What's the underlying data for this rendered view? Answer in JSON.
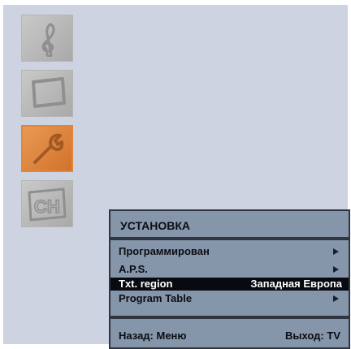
{
  "side_menu": {
    "items": [
      {
        "icon": "sound-clef-icon",
        "active": false
      },
      {
        "icon": "picture-screen-icon",
        "active": false
      },
      {
        "icon": "wrench-icon",
        "active": true
      },
      {
        "icon": "channel-ch-icon",
        "active": false
      }
    ]
  },
  "icon_text": {
    "channel": "CH"
  },
  "setup_menu": {
    "title": "УСТАНОВКА",
    "rows": [
      {
        "label": "Программирован",
        "arrow": true
      },
      {
        "label": "A.P.S.",
        "arrow": true
      },
      {
        "label": "Txt. region",
        "value": "Западная Европа",
        "selected": true
      },
      {
        "label": "Program Table",
        "arrow": true
      }
    ],
    "footer": {
      "back": "Назад: Меню",
      "exit": "Выход: TV"
    }
  },
  "colors": {
    "background": "#cdd3e0",
    "menu_panel": "#8595aa",
    "accent_orange": "#d2722a",
    "selected_row": "#070a10"
  }
}
